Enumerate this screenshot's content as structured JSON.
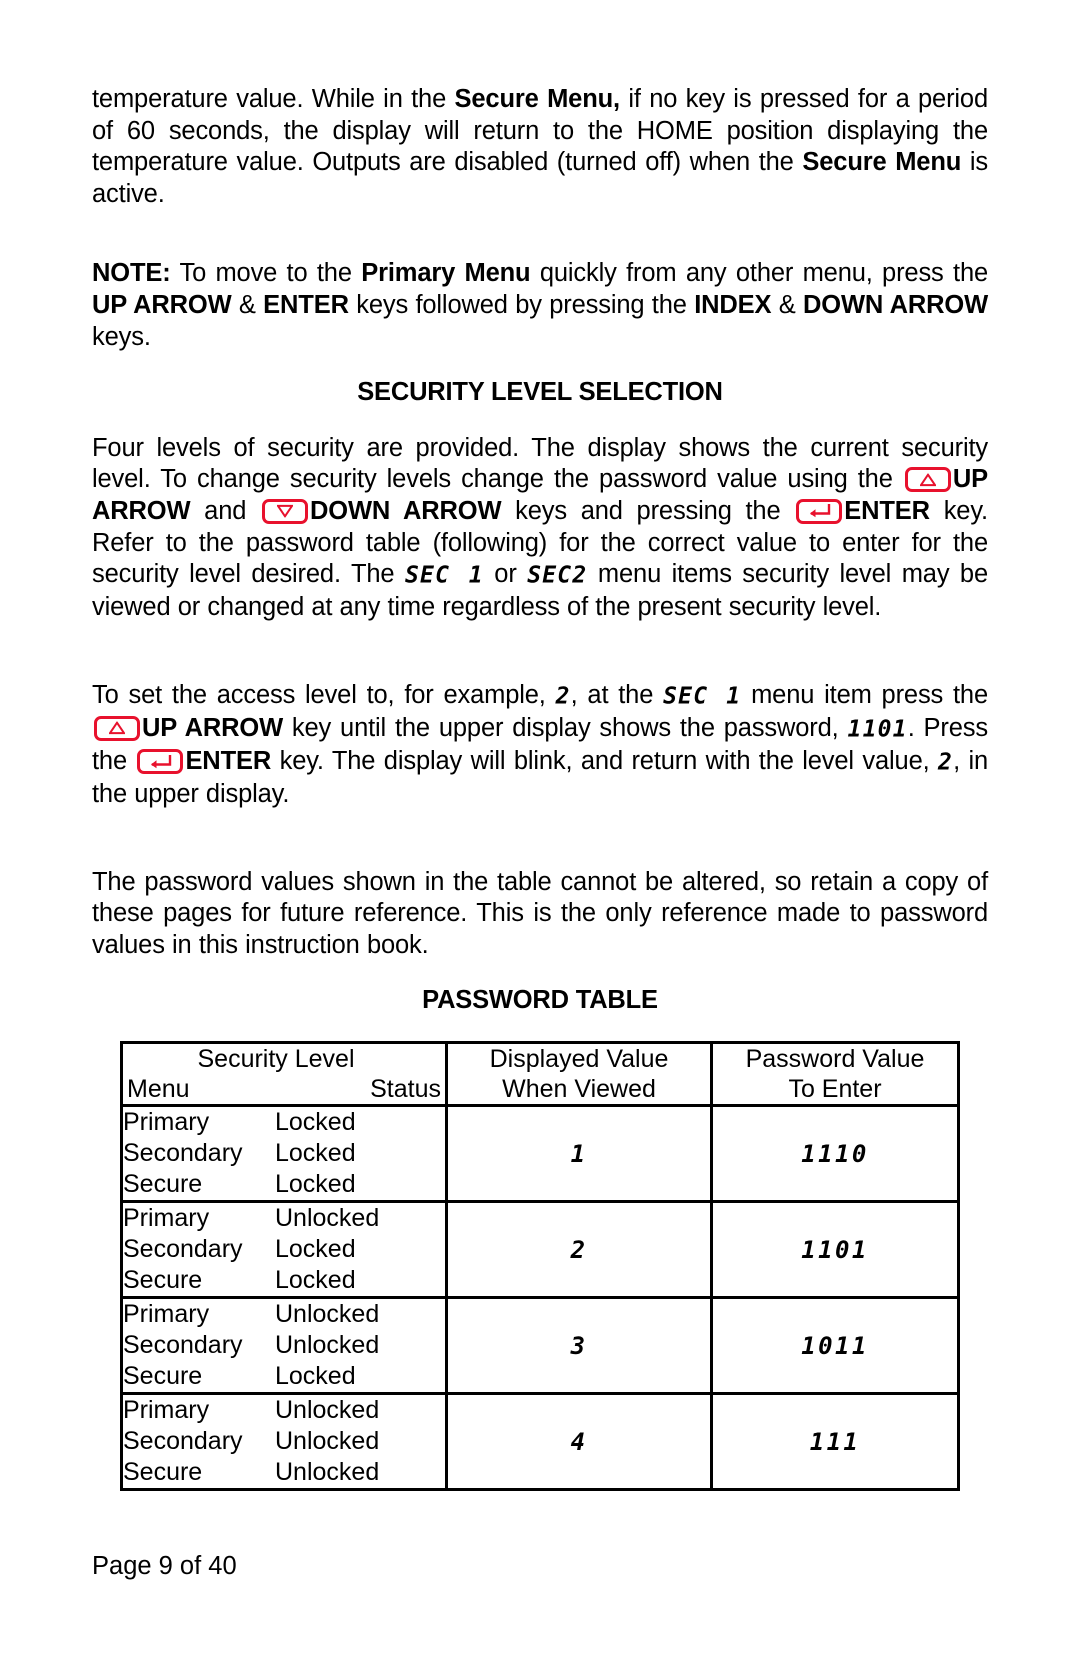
{
  "document": {
    "page_footer": "Page 9 of 40"
  },
  "paragraphs": {
    "secure_menu": {
      "part1": "temperature value. While in the ",
      "bold1": "Secure Menu,",
      "part2": " if no key is pressed for a period of 60 seconds, the display will return to the HOME position displaying the temperature value.  Outputs are disabled (turned off) when the ",
      "bold2": "Secure Menu",
      "part3": " is active."
    },
    "note": {
      "label": "NOTE:",
      "part1": "   To move to the ",
      "bold1": "Primary Menu",
      "part2": " quickly from any other menu, press the ",
      "bold2": "UP ARROW",
      "part3": " & ",
      "bold3": "ENTER",
      "part4": " keys followed by pressing the ",
      "bold4": "INDEX",
      "part5": " & ",
      "bold5": "DOWN ARROW",
      "part6": " keys."
    },
    "security_intro": {
      "part1": "Four levels of security are provided. The display shows the current security level. To change security levels change the password value using the ",
      "bold_up": "UP ARROW",
      "part2": " and ",
      "bold_down": "DOWN ARROW",
      "part3": " keys and pressing the ",
      "bold_enter": "ENTER",
      "part4": " key.   Refer to the password table (following) for the correct value to enter for the security level desired. The ",
      "seg1": "SEC 1",
      "part5": " or ",
      "seg2": "SEC2",
      "part6": " menu items security level may be viewed or changed at any time regardless of the present security level."
    },
    "access_level": {
      "part1": "To set the access level to, for example, ",
      "seg1": "2",
      "part2": ", at the ",
      "seg2": "SEC 1",
      "part3": " menu item press the ",
      "bold_up": "UP ARROW",
      "part4": " key until the upper display shows the password, ",
      "seg3": "1101",
      "part5": ". Press the ",
      "bold_enter": "ENTER",
      "part6": " key.  The display will blink, and return with the level value, ",
      "seg4": "2",
      "part7": ", in the upper display."
    },
    "retain_copy": "The password values shown in the table cannot be altered, so retain a copy of these pages for future reference. This is the only reference made to password values in this instruction book."
  },
  "headings": {
    "security_level_selection": "SECURITY LEVEL SELECTION",
    "password_table": "PASSWORD TABLE"
  },
  "icons": {
    "up_arrow_key": "up-arrow-key-icon",
    "down_arrow_key": "down-arrow-key-icon",
    "enter_key": "enter-key-icon",
    "accent_color": "#e8112d"
  },
  "password_table": {
    "headers": {
      "col1_line1": "Security Level",
      "col1_menu": "Menu",
      "col1_status": "Status",
      "col2": "Displayed Value\nWhen Viewed",
      "col2_line1": "Displayed Value",
      "col2_line2": "When Viewed",
      "col3_line1": "Password Value",
      "col3_line2": "To Enter"
    },
    "menu_names": {
      "primary": "Primary",
      "secondary": "Secondary",
      "secure": "Secure"
    },
    "rows": [
      {
        "primary_status": "Locked",
        "secondary_status": "Locked",
        "secure_status": "Locked",
        "displayed_value": "1",
        "password_value": "1110"
      },
      {
        "primary_status": "Unlocked",
        "secondary_status": "Locked",
        "secure_status": "Locked",
        "displayed_value": "2",
        "password_value": "1101"
      },
      {
        "primary_status": "Unlocked",
        "secondary_status": "Unlocked",
        "secure_status": "Locked",
        "displayed_value": "3",
        "password_value": "1011"
      },
      {
        "primary_status": "Unlocked",
        "secondary_status": "Unlocked",
        "secure_status": "Unlocked",
        "displayed_value": "4",
        "password_value": "111"
      }
    ]
  }
}
